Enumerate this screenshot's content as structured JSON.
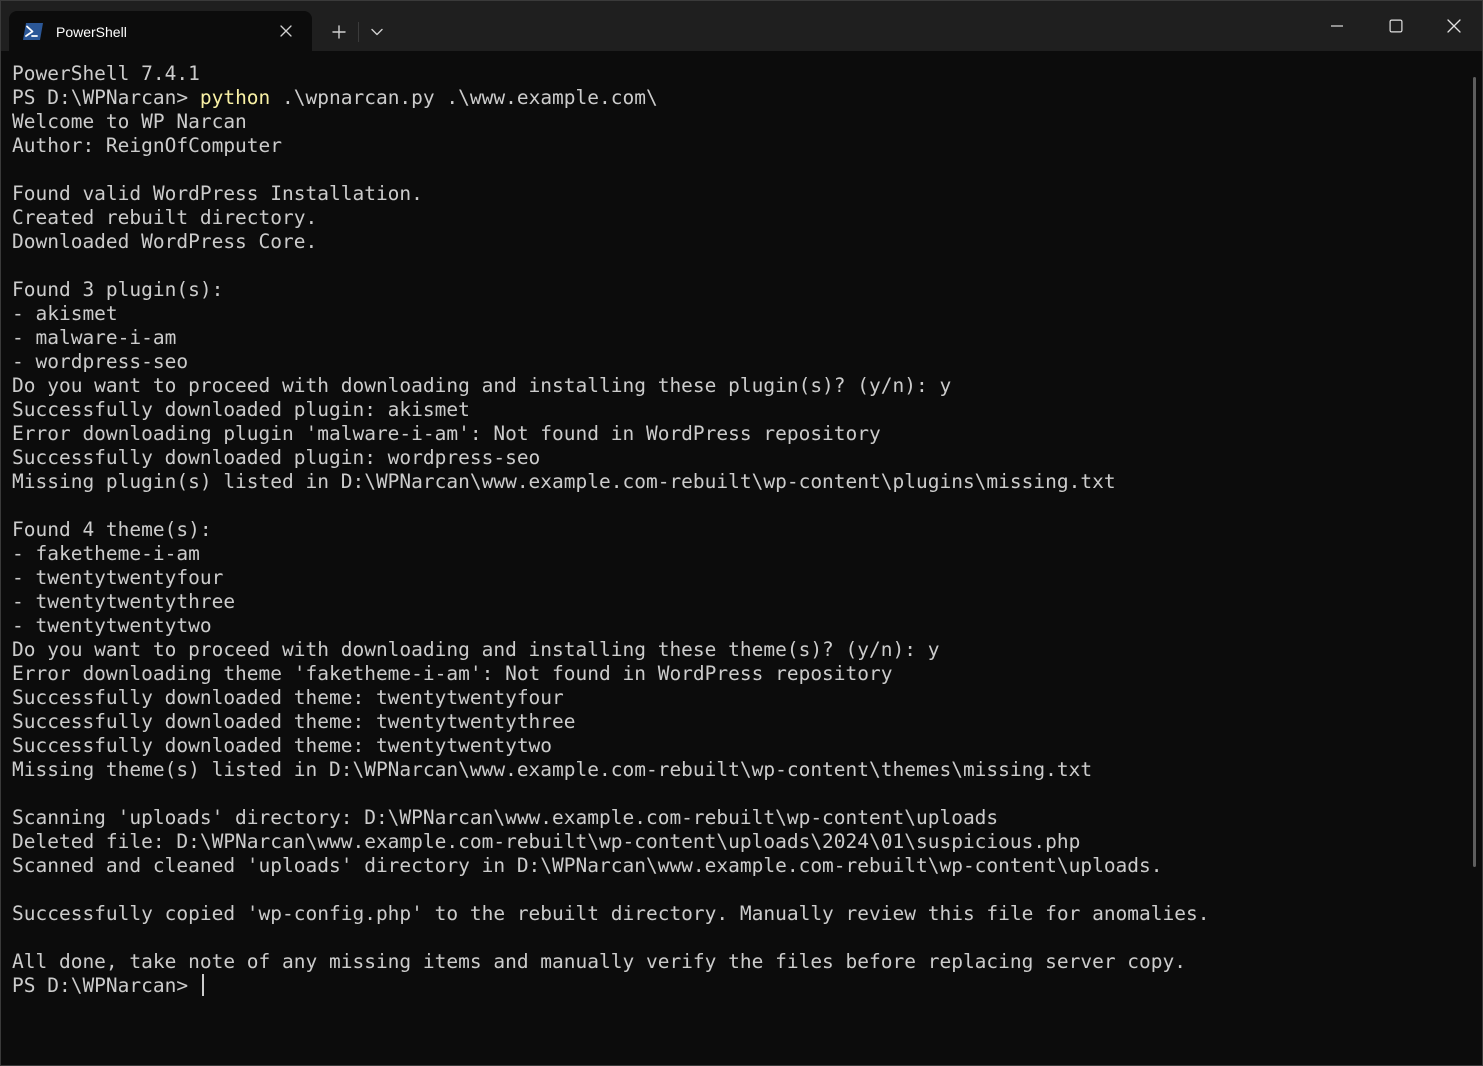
{
  "window": {
    "tab_title": "PowerShell",
    "tab_icon": "powershell-icon",
    "new_tab_icon": "plus-icon",
    "dropdown_icon": "chevron-down-icon",
    "minimize_icon": "minimize-icon",
    "maximize_icon": "maximize-icon",
    "close_icon": "close-icon"
  },
  "terminal": {
    "version_line": "PowerShell 7.4.1",
    "prompt": "PS D:\\WPNarcan> ",
    "command_name": "python",
    "command_args": " .\\wpnarcan.py .\\www.example.com\\",
    "output": [
      "Welcome to WP Narcan",
      "Author: ReignOfComputer",
      "",
      "Found valid WordPress Installation.",
      "Created rebuilt directory.",
      "Downloaded WordPress Core.",
      "",
      "Found 3 plugin(s):",
      "- akismet",
      "- malware-i-am",
      "- wordpress-seo",
      "Do you want to proceed with downloading and installing these plugin(s)? (y/n): y",
      "Successfully downloaded plugin: akismet",
      "Error downloading plugin 'malware-i-am': Not found in WordPress repository",
      "Successfully downloaded plugin: wordpress-seo",
      "Missing plugin(s) listed in D:\\WPNarcan\\www.example.com-rebuilt\\wp-content\\plugins\\missing.txt",
      "",
      "Found 4 theme(s):",
      "- faketheme-i-am",
      "- twentytwentyfour",
      "- twentytwentythree",
      "- twentytwentytwo",
      "Do you want to proceed with downloading and installing these theme(s)? (y/n): y",
      "Error downloading theme 'faketheme-i-am': Not found in WordPress repository",
      "Successfully downloaded theme: twentytwentyfour",
      "Successfully downloaded theme: twentytwentythree",
      "Successfully downloaded theme: twentytwentytwo",
      "Missing theme(s) listed in D:\\WPNarcan\\www.example.com-rebuilt\\wp-content\\themes\\missing.txt",
      "",
      "Scanning 'uploads' directory: D:\\WPNarcan\\www.example.com-rebuilt\\wp-content\\uploads",
      "Deleted file: D:\\WPNarcan\\www.example.com-rebuilt\\wp-content\\uploads\\2024\\01\\suspicious.php",
      "Scanned and cleaned 'uploads' directory in D:\\WPNarcan\\www.example.com-rebuilt\\wp-content\\uploads.",
      "",
      "Successfully copied 'wp-config.php' to the rebuilt directory. Manually review this file for anomalies.",
      "",
      "All done, take note of any missing items and manually verify the files before replacing server copy."
    ],
    "final_prompt": "PS D:\\WPNarcan> "
  },
  "colors": {
    "background": "#0c0c0c",
    "text": "#cccccc",
    "command": "#f9f1a5",
    "titlebar": "#1f1f1f"
  }
}
